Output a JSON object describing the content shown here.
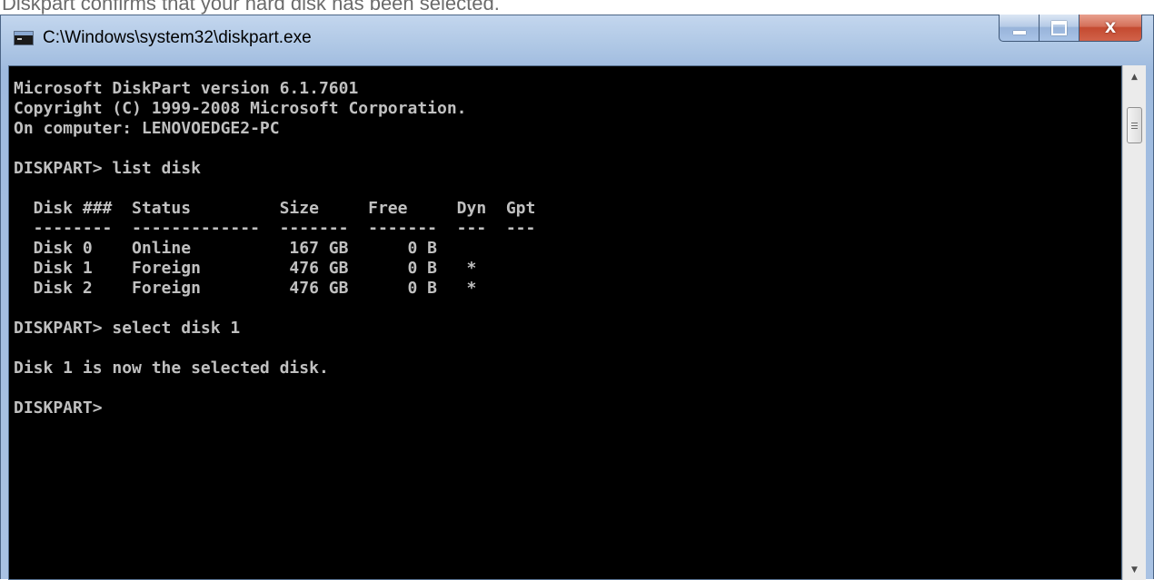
{
  "caption": "Diskpart confirms that your hard disk has been selected.",
  "window": {
    "title": "C:\\Windows\\system32\\diskpart.exe",
    "icon": "console-app-icon",
    "buttons": {
      "minimize_icon": "minimize-icon",
      "maximize_icon": "maximize-icon",
      "close_label": "X"
    }
  },
  "console": {
    "lines": [
      "Microsoft DiskPart version 6.1.7601",
      "Copyright (C) 1999-2008 Microsoft Corporation.",
      "On computer: LENOVOEDGE2-PC",
      "",
      "DISKPART> list disk",
      "",
      "  Disk ###  Status         Size     Free     Dyn  Gpt",
      "  --------  -------------  -------  -------  ---  ---",
      "  Disk 0    Online          167 GB      0 B",
      "  Disk 1    Foreign         476 GB      0 B   *",
      "  Disk 2    Foreign         476 GB      0 B   *",
      "",
      "DISKPART> select disk 1",
      "",
      "Disk 1 is now the selected disk.",
      "",
      "DISKPART> "
    ]
  },
  "scrollbar": {
    "up_glyph": "▲",
    "down_glyph": "▼"
  },
  "colors": {
    "console_bg": "#000000",
    "console_text": "#c0c0c0",
    "close_button": "#c44a30",
    "titlebar": "#b1c9e6"
  }
}
